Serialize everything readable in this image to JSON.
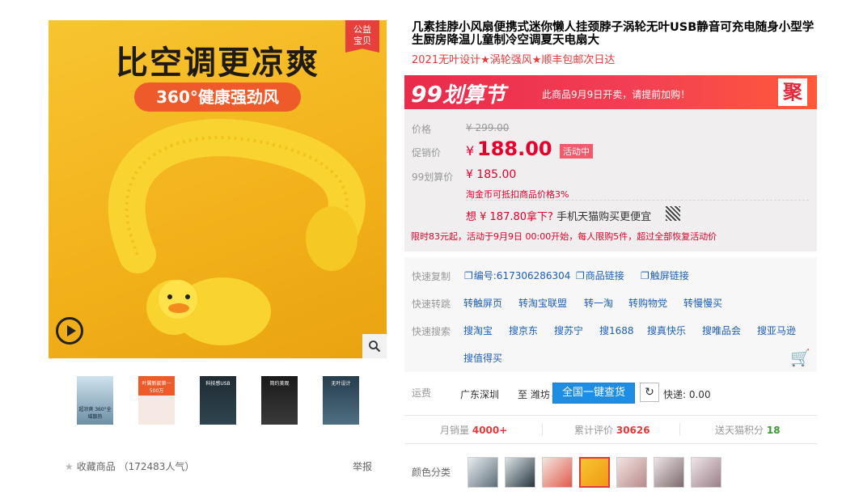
{
  "gallery": {
    "headline": "比空调更凉爽",
    "pill": "360°健康强劲风",
    "badge_line1": "公益",
    "badge_line2": "宝贝",
    "thumbs": [
      {
        "text": "超凉爽\n360°全域散热"
      },
      {
        "text": "叶翼新款第一\n500万"
      },
      {
        "text": "科技感USB"
      },
      {
        "text": "简约美观"
      },
      {
        "text": "无叶设计"
      }
    ],
    "favorite_label": "收藏商品",
    "popularity": "（172483人气）",
    "report": "举报"
  },
  "product": {
    "title": "几素挂脖小风扇便携式迷你懒人挂颈脖子涡轮无叶USB静音可充电随身小型学生厨房降温儿童制冷空调夏天电扇大",
    "subtitle": "2021无叶设计★涡轮强风★顺丰包邮次日达"
  },
  "promo": {
    "logo_num": "99",
    "logo_text": "划算节",
    "notice": "此商品9月9日开卖，请提前加购！",
    "ju": "聚"
  },
  "price": {
    "label_price": "价格",
    "original": "¥ 299.00",
    "label_promo": "促销价",
    "yen": "¥",
    "promo_value": "188.00",
    "activity_tag": "活动中",
    "label_99": "99划算价",
    "p99_value": "¥ 185.00",
    "coins": "淘金币可抵扣商品价格3%",
    "want_prefix": "想 ¥ 187.80拿下?",
    "want_suffix": "手机天猫购买更便宜",
    "limit": "限时83元起，活动于9月9日 00:00开始，每人限购5件，超过全部恢复活动价"
  },
  "tools": {
    "copy_label": "快速复制",
    "copy_links": [
      "编号:617306286304",
      "商品链接",
      "触屏链接"
    ],
    "jump_label": "快速转跳",
    "jump_links": [
      "转触屏页",
      "转淘宝联盟",
      "转一淘",
      "转购物党",
      "转慢慢买"
    ],
    "search_label": "快速搜索",
    "search_links": [
      "搜淘宝",
      "搜京东",
      "搜苏宁",
      "搜1688",
      "搜真快乐",
      "搜唯品会",
      "搜亚马逊",
      "搜值得买"
    ]
  },
  "shipping": {
    "label": "运费",
    "from": "广东深圳",
    "to": "至 潍坊⌄",
    "query_button": "全国一键查货",
    "express": "快递: 0.00"
  },
  "stats": {
    "monthly_label": "月销量",
    "monthly_value": "4000+",
    "review_label": "累计评价",
    "review_value": "30626",
    "points_label": "送天猫积分",
    "points_value": "18"
  },
  "colors": {
    "label": "颜色分类",
    "selected_index": 3
  }
}
